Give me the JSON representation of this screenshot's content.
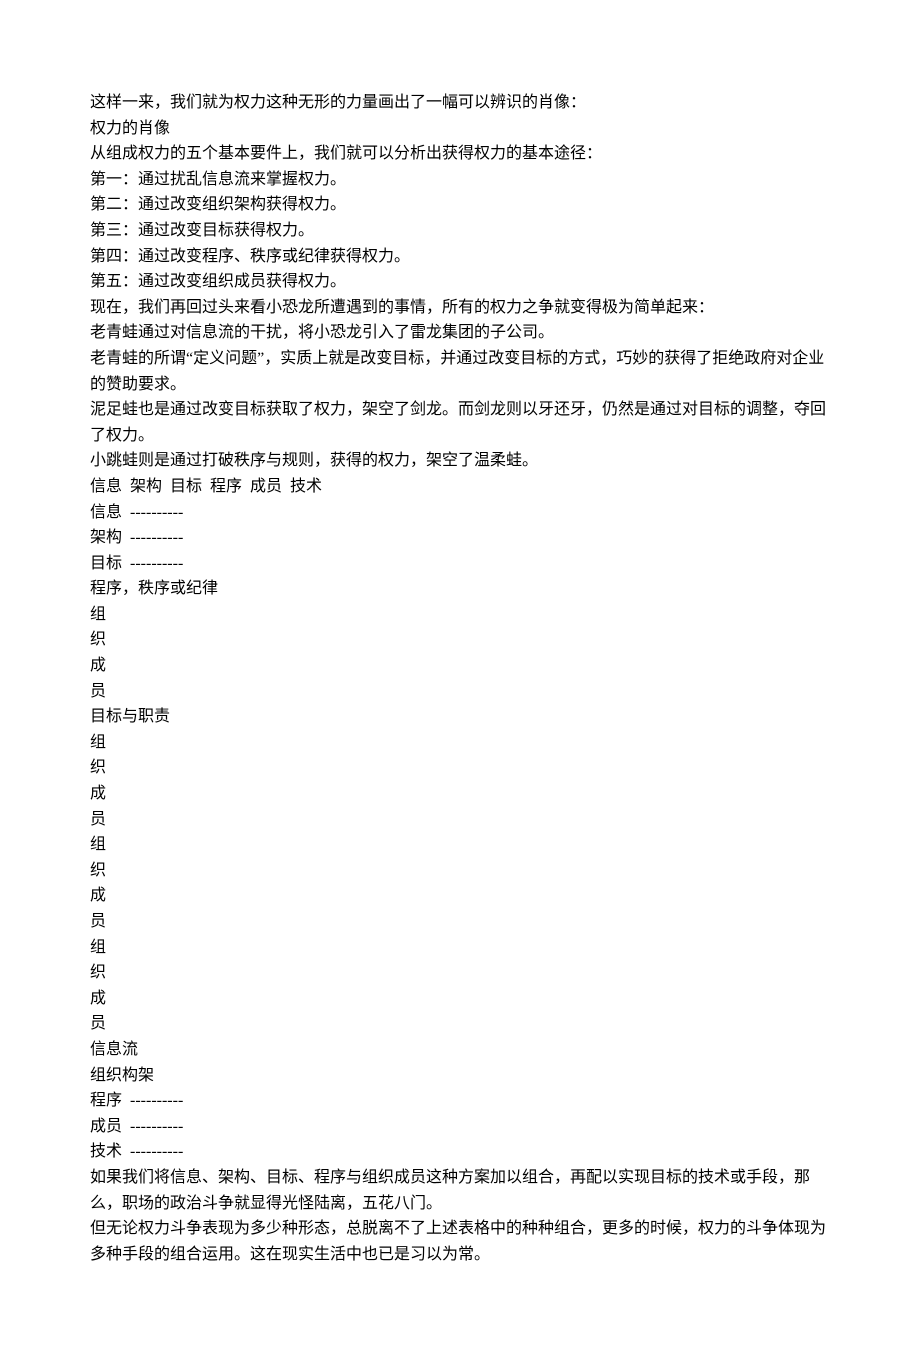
{
  "lines": [
    "这样一来，我们就为权力这种无形的力量画出了一幅可以辨识的肖像：",
    "权力的肖像",
    "从组成权力的五个基本要件上，我们就可以分析出获得权力的基本途径：",
    "第一：通过扰乱信息流来掌握权力。",
    "第二：通过改变组织架构获得权力。",
    "第三：通过改变目标获得权力。",
    "第四：通过改变程序、秩序或纪律获得权力。",
    "第五：通过改变组织成员获得权力。",
    "现在，我们再回过头来看小恐龙所遭遇到的事情，所有的权力之争就变得极为简单起来：",
    "老青蛙通过对信息流的干扰，将小恐龙引入了雷龙集团的子公司。",
    "老青蛙的所谓“定义问题”，实质上就是改变目标，并通过改变目标的方式，巧妙的获得了拒绝政府对企业的赞助要求。",
    "泥足蛙也是通过改变目标获取了权力，架空了剑龙。而剑龙则以牙还牙，仍然是通过对目标的调整，夺回了权力。",
    "小跳蛙则是通过打破秩序与规则，获得的权力，架空了温柔蛙。",
    "信息  架构  目标  程序  成员  技术",
    "信息  ----------",
    "架构  ----------",
    "目标  ----------",
    "程序，秩序或纪律",
    "组",
    "织",
    "成",
    "员",
    "目标与职责",
    "组",
    "织",
    "成",
    "员",
    "组",
    "织",
    "成",
    "员",
    "组",
    "织",
    "成",
    "员",
    "信息流",
    "组织构架",
    "程序  ----------",
    "成员  ----------",
    "技术  ----------",
    "如果我们将信息、架构、目标、程序与组织成员这种方案加以组合，再配以实现目标的技术或手段，那么，职场的政治斗争就显得光怪陆离，五花八门。",
    "但无论权力斗争表现为多少种形态，总脱离不了上述表格中的种种组合，更多的时候，权力的斗争体现为多种手段的组合运用。这在现实生活中也已是习以为常。"
  ]
}
